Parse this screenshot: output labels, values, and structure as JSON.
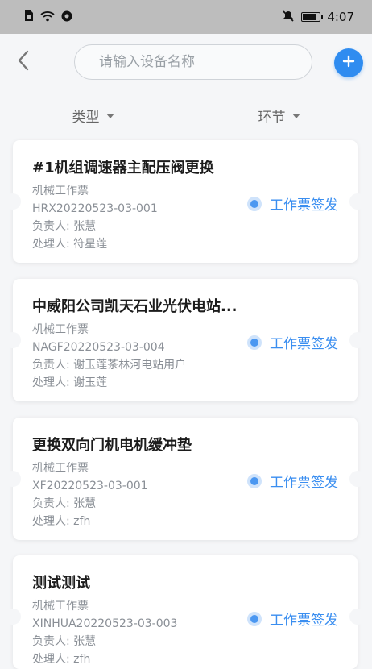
{
  "status_bar": {
    "time": "4:07"
  },
  "header": {
    "search": {
      "placeholder": "请输入设备名称",
      "value": ""
    }
  },
  "filters": [
    {
      "label": "类型"
    },
    {
      "label": "环节"
    }
  ],
  "colors": {
    "accent": "#2f8cf0",
    "status_text": "#3a8ef0",
    "background": "#f5f6f8",
    "status_bar": "#bdbdbd"
  },
  "icons": {
    "back": "chevron-left-icon",
    "add": "plus-icon",
    "filter_caret": "caret-down-icon"
  },
  "tickets": [
    {
      "title": "#1机组调速器主配压阀更换",
      "type": "机械工作票",
      "code": "HRX20220523-03-001",
      "owner": "负责人: 张慧",
      "handler": "处理人: 符星莲",
      "status": "工作票签发"
    },
    {
      "title": "中威阳公司凯天石业光伏电站...",
      "type": "机械工作票",
      "code": "NAGF20220523-03-004",
      "owner": "负责人: 谢玉莲茶林河电站用户",
      "handler": "处理人: 谢玉莲",
      "status": "工作票签发"
    },
    {
      "title": "更换双向门机电机缓冲垫",
      "type": "机械工作票",
      "code": "XF20220523-03-001",
      "owner": "负责人: 张慧",
      "handler": "处理人: zfh",
      "status": "工作票签发"
    },
    {
      "title": "测试测试",
      "type": "机械工作票",
      "code": "XINHUA20220523-03-003",
      "owner": "负责人: 张慧",
      "handler": "处理人: zfh",
      "status": "工作票签发"
    }
  ]
}
